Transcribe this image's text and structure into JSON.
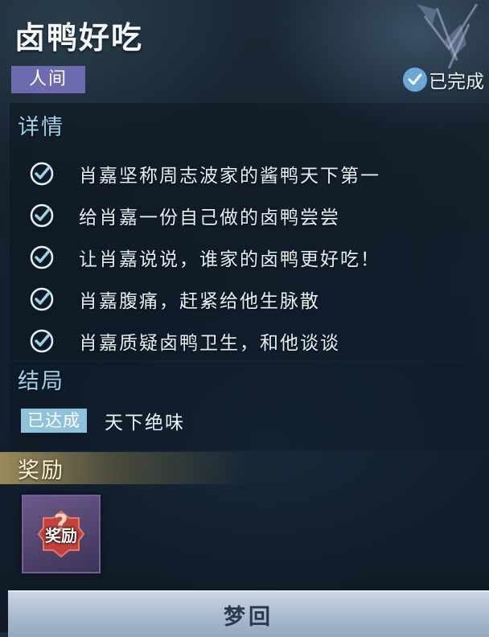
{
  "quest": {
    "title": "卤鸭好吃",
    "realm_tag": "人间",
    "status": "已完成"
  },
  "details": {
    "heading": "详情",
    "tasks": [
      {
        "text": "肖嘉坚称周志波家的酱鸭天下第一",
        "done": true
      },
      {
        "text": "给肖嘉一份自己做的卤鸭尝尝",
        "done": true
      },
      {
        "text": "让肖嘉说说，谁家的卤鸭更好吃！",
        "done": true
      },
      {
        "text": "肖嘉腹痛，赶紧给他生脉散",
        "done": true
      },
      {
        "text": "肖嘉质疑卤鸭卫生，和他谈谈",
        "done": true
      }
    ]
  },
  "ending": {
    "heading": "结局",
    "badge": "已达成",
    "name": "天下绝味"
  },
  "reward": {
    "heading": "奖励",
    "item_label": "奖励"
  },
  "action": {
    "button_label": "梦回"
  },
  "colors": {
    "accent_blue": "#9fd2ea",
    "realm_tag": "#6e6ab0",
    "ending_badge": "#8ec2dc",
    "reward_gold": "#b29e60"
  },
  "icons": {
    "task_check": "check-circle-icon",
    "status_check": "check-badge-icon",
    "reward": "mystery-reward-icon",
    "emblem": "crystal-emblem-icon"
  }
}
